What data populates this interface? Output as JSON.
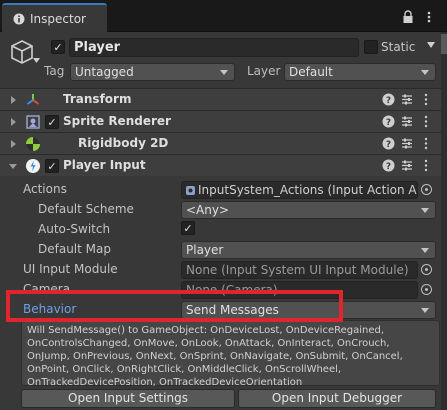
{
  "tab": {
    "title": "Inspector"
  },
  "header": {
    "object_name": "Player",
    "active_checked": "✓",
    "static_label": "Static",
    "tag_label": "Tag",
    "tag_value": "Untagged",
    "layer_label": "Layer",
    "layer_value": "Default"
  },
  "components": [
    {
      "title": "Transform",
      "icon": "transform-icon",
      "expanded": false
    },
    {
      "title": "Sprite Renderer",
      "icon": "sprite-renderer-icon",
      "enabled": "✓",
      "expanded": false
    },
    {
      "title": "Rigidbody 2D",
      "icon": "rigidbody-2d-icon",
      "expanded": false
    },
    {
      "title": "Player Input",
      "icon": "player-input-icon",
      "enabled": "✓",
      "expanded": true
    }
  ],
  "player_input": {
    "actions_label": "Actions",
    "actions_value": "InputSystem_Actions (Input Action Ass",
    "default_scheme_label": "Default Scheme",
    "default_scheme_value": "<Any>",
    "auto_switch_label": "Auto-Switch",
    "auto_switch_checked": "✓",
    "default_map_label": "Default Map",
    "default_map_value": "Player",
    "ui_module_label": "UI Input Module",
    "ui_module_value": "None (Input System UI Input Module)",
    "camera_label": "Camera",
    "camera_value": "None (Camera)",
    "behavior_label": "Behavior",
    "behavior_value": "Send Messages",
    "help_text": "Will SendMessage() to GameObject: OnDeviceLost, OnDeviceRegained, OnControlsChanged, OnMove, OnLook, OnAttack, OnInteract, OnCrouch, OnJump, OnPrevious, OnNext, OnSprint, OnNavigate, OnSubmit, OnCancel, OnPoint, OnClick, OnRightClick, OnMiddleClick, OnScrollWheel, OnTrackedDevicePosition, OnTrackedDeviceOrientation",
    "open_settings_label": "Open Input Settings",
    "open_debugger_label": "Open Input Debugger"
  },
  "colors": {
    "panel": "#383838",
    "highlight": "#e0252d",
    "behavior_label": "#6ea0e6"
  }
}
